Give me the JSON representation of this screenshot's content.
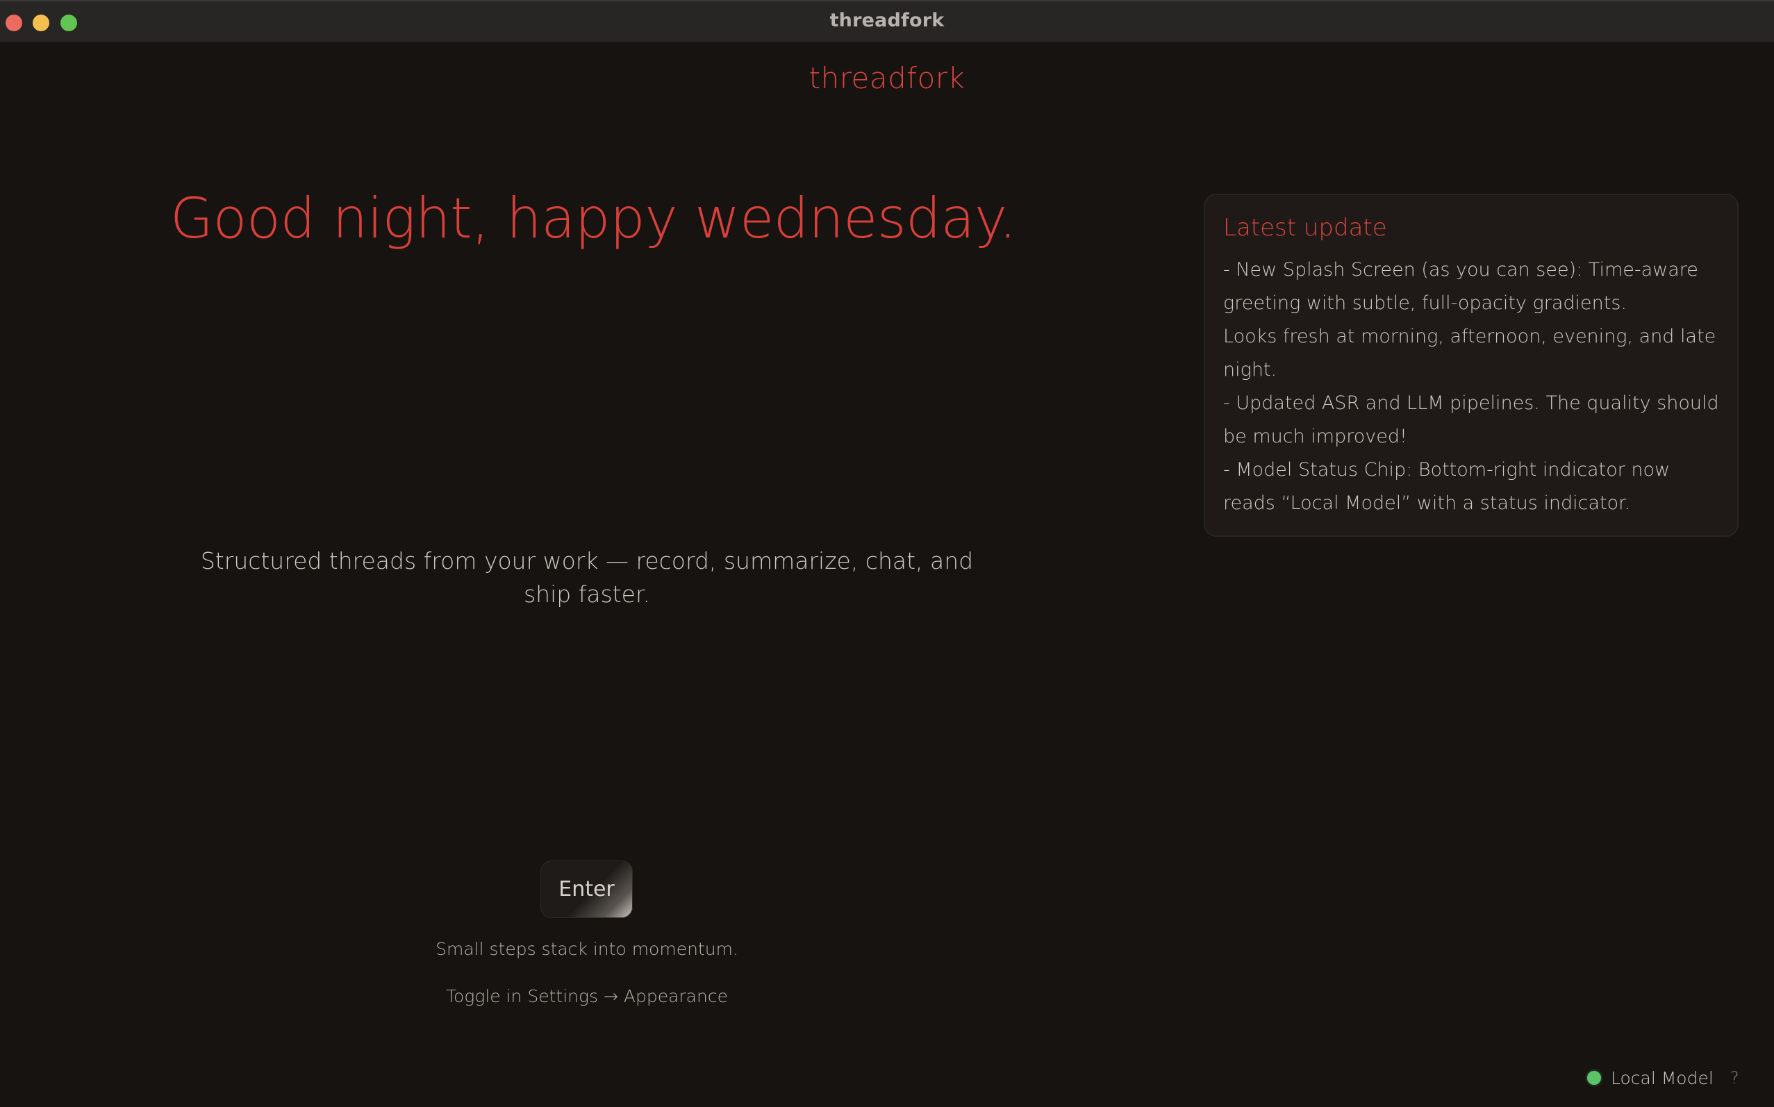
{
  "window": {
    "title": "threadfork"
  },
  "brand": {
    "name": "threadfork",
    "color": "#d9463d"
  },
  "splash": {
    "greeting": "Good night, happy wednesday.",
    "tagline": "Structured threads from your work — record, summarize, chat, and ship faster.",
    "enter_label": "Enter",
    "motto": "Small steps stack into momentum.",
    "toggle_hint": "Toggle in Settings → Appearance"
  },
  "update_card": {
    "title": "Latest update",
    "lines": [
      "- New Splash Screen (as you can see): Time-aware greeting with subtle, full-opacity gradients.",
      "Looks fresh at morning, afternoon, evening, and late night.",
      "- Updated ASR and LLM pipelines. The quality should be much improved!",
      "- Model Status Chip: Bottom-right indicator now reads “Local Model” with a status indicator."
    ]
  },
  "status": {
    "label": "Local Model",
    "indicator_color": "#5cc36a",
    "help_glyph": "?"
  },
  "colors": {
    "background": "#171310",
    "titlebar": "#282624",
    "accent": "#d9403a",
    "text": "#cfc8c0"
  },
  "icons": {
    "close": "close-window-icon",
    "minimize": "minimize-window-icon",
    "maximize": "maximize-window-icon",
    "status": "status-dot-icon",
    "help": "help-icon"
  }
}
